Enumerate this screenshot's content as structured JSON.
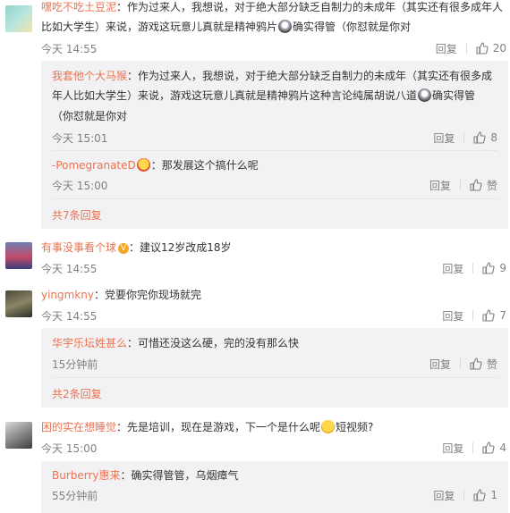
{
  "comments": [
    {
      "user": "嘿吃不吃土豆泥",
      "text_line1": "：作为过来人，我想说，对于绝大部分缺乏自制力的未成年（其实还有很多成年人",
      "text_line2a": "比如大学生）来说，游戏这玩意儿真就是精神鸦片",
      "text_line2b": "确实得管（你怼就是你对",
      "time": "今天 14:55",
      "reply_label": "回复",
      "likes": "20",
      "replies": [
        {
          "user": "我套他个大马猴",
          "text_line1": "：作为过来人，我想说，对于绝大部分缺乏自制力的未成年（其实还有很多成",
          "text_line2a": "年人比如大学生）来说，游戏这玩意儿真就是精神鸦片这种言论纯属胡说八道",
          "text_line2b": "确实得管",
          "text_line3": "（你怼就是你对",
          "time": "今天 15:01",
          "reply_label": "回复",
          "likes": "8"
        },
        {
          "user": "-PomegranateD",
          "text": "：那发展这个搞什么呢",
          "time": "今天 15:00",
          "reply_label": "回复",
          "likes": "赞"
        }
      ],
      "more_replies": "共7条回复"
    },
    {
      "user": "有事没事看个球",
      "text": "：建议12岁改成18岁",
      "badge": "V",
      "time": "今天 14:55",
      "reply_label": "回复",
      "likes": "9"
    },
    {
      "user": "yingmkny",
      "text": "：党要你完你现场就完",
      "time": "今天 14:55",
      "reply_label": "回复",
      "likes": "7",
      "replies": [
        {
          "user": "华宇乐坛姓甚么",
          "text": "：可惜还没这么硬，完的没有那么快",
          "time": "15分钟前",
          "reply_label": "回复",
          "likes": "赞"
        }
      ],
      "more_replies": "共2条回复"
    },
    {
      "user": "困的实在想睡觉",
      "text_a": "：先是培训，现在是游戏，下一个是什么呢",
      "text_b": "短视频?",
      "time": "今天 15:00",
      "reply_label": "回复",
      "likes": "4",
      "replies": [
        {
          "user": "Burberry惠来",
          "text": "：确实得管管，乌烟瘴气",
          "time": "55分钟前",
          "reply_label": "回复",
          "likes": "1"
        }
      ]
    }
  ],
  "colors": {
    "username": "#eb7350",
    "text": "#333333",
    "meta": "#808080",
    "reply_bg": "#f2f2f5"
  },
  "icons": {
    "like": "thumbs-up-icon",
    "emoji": "emoji-icon"
  }
}
